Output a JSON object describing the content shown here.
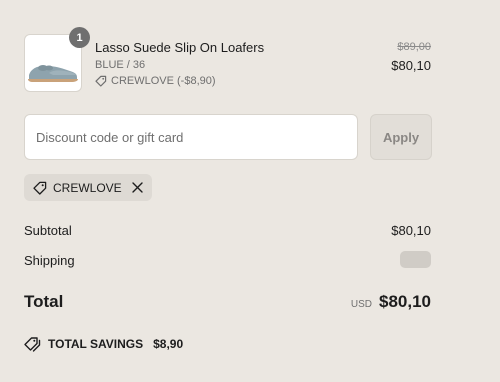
{
  "item": {
    "quantity": "1",
    "title": "Lasso Suede Slip On Loafers",
    "variant": "BLUE / 36",
    "discount": "CREWLOVE (-$8,90)",
    "price_original": "$89,00",
    "price_final": "$80,10",
    "image_icon": "loafer-image-icon"
  },
  "discount_form": {
    "placeholder": "Discount code or gift card",
    "value": "",
    "apply_label": "Apply"
  },
  "applied_code": {
    "code": "CREWLOVE",
    "tag_icon": "tag-icon",
    "remove_icon": "close-icon"
  },
  "summary": {
    "subtotal_label": "Subtotal",
    "subtotal_value": "$80,10",
    "shipping_label": "Shipping",
    "total_label": "Total",
    "currency": "USD",
    "total_value": "$80,10",
    "savings_label": "TOTAL SAVINGS",
    "savings_value": "$8,90"
  },
  "colors": {
    "background": "#ebe7e1",
    "badge": "#6f6f6f",
    "text": "#1d1d1d",
    "muted": "#6f6f6f"
  }
}
